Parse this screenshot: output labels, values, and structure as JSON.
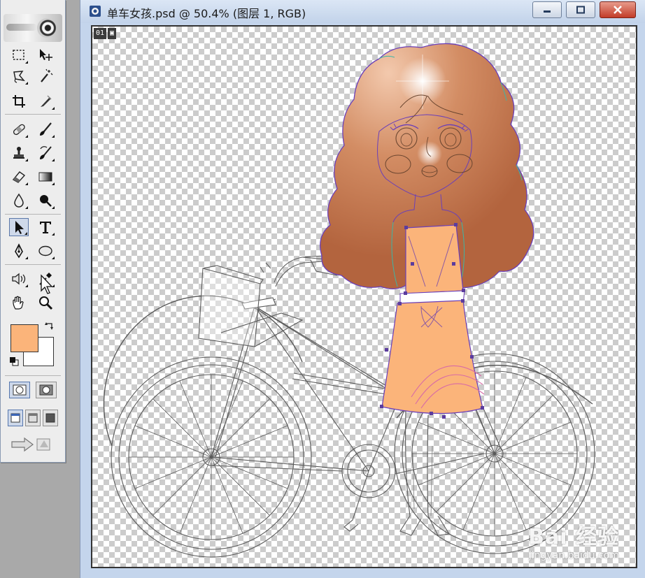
{
  "window": {
    "title": "单车女孩.psd @ 50.4% (图层 1, RGB)",
    "frame_number": "01"
  },
  "toolbox": {
    "tools": [
      {
        "name": "rectangular-marquee-tool"
      },
      {
        "name": "move-tool"
      },
      {
        "name": "lasso-tool"
      },
      {
        "name": "magic-wand-tool"
      },
      {
        "name": "crop-tool"
      },
      {
        "name": "slice-tool"
      },
      {
        "name": "healing-brush-tool"
      },
      {
        "name": "brush-tool"
      },
      {
        "name": "clone-stamp-tool"
      },
      {
        "name": "history-brush-tool"
      },
      {
        "name": "eraser-tool"
      },
      {
        "name": "gradient-tool"
      },
      {
        "name": "blur-tool"
      },
      {
        "name": "dodge-tool"
      },
      {
        "name": "path-selection-tool",
        "active": true
      },
      {
        "name": "type-tool"
      },
      {
        "name": "pen-tool"
      },
      {
        "name": "ellipse-tool"
      },
      {
        "name": "notes-tool"
      },
      {
        "name": "eyedropper-tool"
      },
      {
        "name": "hand-tool"
      },
      {
        "name": "zoom-tool"
      }
    ],
    "foreground_color": "#fbb47a",
    "background_color": "#ffffff"
  },
  "colors": {
    "dress": "#fbb47a",
    "hair_dark": "#b3643e",
    "hair_light": "#f3c9ad",
    "path_line": "#6a3fb8",
    "titlebar": "#c4d5ec"
  },
  "watermark": {
    "line1": "Bai 经验",
    "line2": "jingyan.baidu.com"
  }
}
